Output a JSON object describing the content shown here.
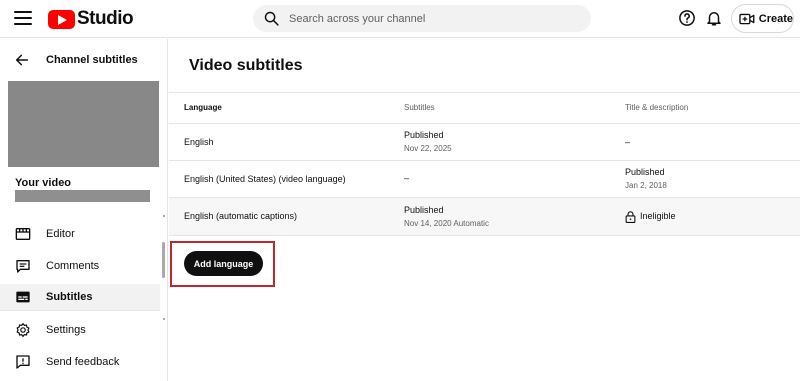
{
  "header": {
    "logo_text": "Studio",
    "search_placeholder": "Search across your channel",
    "create_label": "Create"
  },
  "sidebar": {
    "back_title": "Channel subtitles",
    "your_video_label": "Your video",
    "items": [
      {
        "label": "Editor",
        "icon": "editor-icon"
      },
      {
        "label": "Comments",
        "icon": "comments-icon"
      },
      {
        "label": "Subtitles",
        "icon": "subtitles-icon",
        "active": true
      },
      {
        "label": "Settings",
        "icon": "gear-icon"
      },
      {
        "label": "Send feedback",
        "icon": "feedback-icon"
      }
    ]
  },
  "main": {
    "title": "Video subtitles",
    "columns": [
      "Language",
      "Subtitles",
      "Title & description"
    ],
    "rows": [
      {
        "language": "English",
        "subtitles_status": "Published",
        "subtitles_date": "Nov 22, 2025",
        "title_status": "–",
        "title_date": ""
      },
      {
        "language": "English (United States) (video language)",
        "subtitles_status": "–",
        "subtitles_date": "",
        "title_status": "Published",
        "title_date": "Jan 2, 2018"
      },
      {
        "language": "English (automatic captions)",
        "subtitles_status": "Published",
        "subtitles_date": "Nov 14, 2020 Automatic",
        "title_status": "Ineligible",
        "title_date": ""
      }
    ],
    "add_language_label": "Add language"
  },
  "colors": {
    "brand_red": "#ff0000",
    "highlight_red": "#c0272d",
    "button_dark": "#0f0f0f"
  }
}
